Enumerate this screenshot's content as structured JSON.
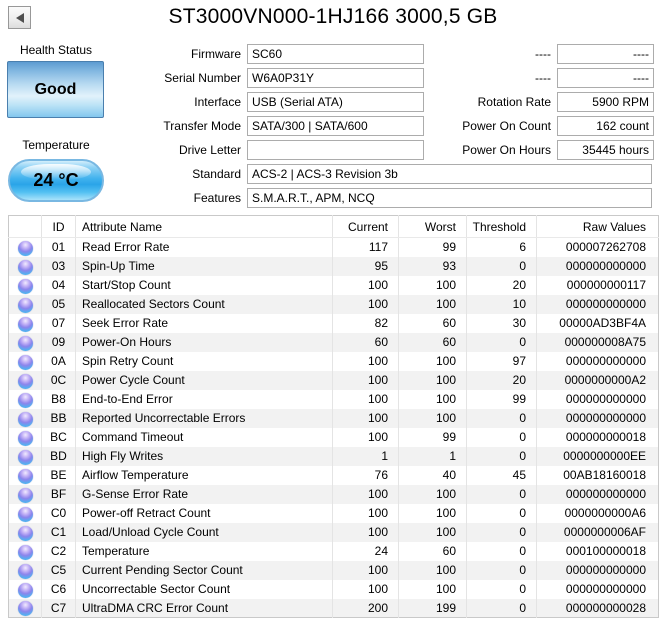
{
  "window": {
    "title": "ST3000VN000-1HJ166 3000,5 GB",
    "back_icon": "back-arrow-icon"
  },
  "health": {
    "label": "Health Status",
    "status": "Good"
  },
  "temperature": {
    "label": "Temperature",
    "value": "24 °C"
  },
  "colors": {
    "health_good_blue": "#4db0ee",
    "orb_status_blue": "#54aef0"
  },
  "fields_left": [
    {
      "label": "Firmware",
      "value": "SC60"
    },
    {
      "label": "Serial Number",
      "value": "W6A0P31Y"
    },
    {
      "label": "Interface",
      "value": "USB (Serial ATA)"
    },
    {
      "label": "Transfer Mode",
      "value": "SATA/300 | SATA/600"
    },
    {
      "label": "Drive Letter",
      "value": ""
    }
  ],
  "fields_wide": [
    {
      "label": "Standard",
      "value": "ACS-2 | ACS-3 Revision 3b"
    },
    {
      "label": "Features",
      "value": "S.M.A.R.T., APM, NCQ"
    }
  ],
  "fields_right": [
    {
      "label": "----",
      "value": "----"
    },
    {
      "label": "----",
      "value": "----"
    },
    {
      "label": "Rotation Rate",
      "value": "5900 RPM"
    },
    {
      "label": "Power On Count",
      "value": "162 count"
    },
    {
      "label": "Power On Hours",
      "value": "35445 hours"
    }
  ],
  "smart_table": {
    "status_icon": "status-orb-icon",
    "headers": [
      "ID",
      "Attribute Name",
      "Current",
      "Worst",
      "Threshold",
      "Raw Values"
    ],
    "rows": [
      {
        "id": "01",
        "name": "Read Error Rate",
        "current": "117",
        "worst": "99",
        "threshold": "6",
        "raw": "000007262708"
      },
      {
        "id": "03",
        "name": "Spin-Up Time",
        "current": "95",
        "worst": "93",
        "threshold": "0",
        "raw": "000000000000"
      },
      {
        "id": "04",
        "name": "Start/Stop Count",
        "current": "100",
        "worst": "100",
        "threshold": "20",
        "raw": "000000000117"
      },
      {
        "id": "05",
        "name": "Reallocated Sectors Count",
        "current": "100",
        "worst": "100",
        "threshold": "10",
        "raw": "000000000000"
      },
      {
        "id": "07",
        "name": "Seek Error Rate",
        "current": "82",
        "worst": "60",
        "threshold": "30",
        "raw": "00000AD3BF4A"
      },
      {
        "id": "09",
        "name": "Power-On Hours",
        "current": "60",
        "worst": "60",
        "threshold": "0",
        "raw": "000000008A75"
      },
      {
        "id": "0A",
        "name": "Spin Retry Count",
        "current": "100",
        "worst": "100",
        "threshold": "97",
        "raw": "000000000000"
      },
      {
        "id": "0C",
        "name": "Power Cycle Count",
        "current": "100",
        "worst": "100",
        "threshold": "20",
        "raw": "0000000000A2"
      },
      {
        "id": "B8",
        "name": "End-to-End Error",
        "current": "100",
        "worst": "100",
        "threshold": "99",
        "raw": "000000000000"
      },
      {
        "id": "BB",
        "name": "Reported Uncorrectable Errors",
        "current": "100",
        "worst": "100",
        "threshold": "0",
        "raw": "000000000000"
      },
      {
        "id": "BC",
        "name": "Command Timeout",
        "current": "100",
        "worst": "99",
        "threshold": "0",
        "raw": "000000000018"
      },
      {
        "id": "BD",
        "name": "High Fly Writes",
        "current": "1",
        "worst": "1",
        "threshold": "0",
        "raw": "0000000000EE"
      },
      {
        "id": "BE",
        "name": "Airflow Temperature",
        "current": "76",
        "worst": "40",
        "threshold": "45",
        "raw": "00AB18160018"
      },
      {
        "id": "BF",
        "name": "G-Sense Error Rate",
        "current": "100",
        "worst": "100",
        "threshold": "0",
        "raw": "000000000000"
      },
      {
        "id": "C0",
        "name": "Power-off Retract Count",
        "current": "100",
        "worst": "100",
        "threshold": "0",
        "raw": "0000000000A6"
      },
      {
        "id": "C1",
        "name": "Load/Unload Cycle Count",
        "current": "100",
        "worst": "100",
        "threshold": "0",
        "raw": "0000000006AF"
      },
      {
        "id": "C2",
        "name": "Temperature",
        "current": "24",
        "worst": "60",
        "threshold": "0",
        "raw": "000100000018"
      },
      {
        "id": "C5",
        "name": "Current Pending Sector Count",
        "current": "100",
        "worst": "100",
        "threshold": "0",
        "raw": "000000000000"
      },
      {
        "id": "C6",
        "name": "Uncorrectable Sector Count",
        "current": "100",
        "worst": "100",
        "threshold": "0",
        "raw": "000000000000"
      },
      {
        "id": "C7",
        "name": "UltraDMA CRC Error Count",
        "current": "200",
        "worst": "199",
        "threshold": "0",
        "raw": "000000000028"
      }
    ]
  }
}
